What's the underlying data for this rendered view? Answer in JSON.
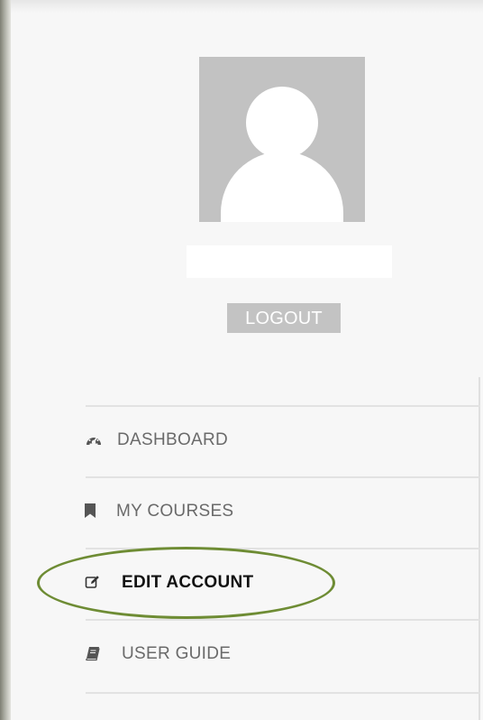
{
  "profile": {
    "username": "",
    "logout_label": "LOGOUT"
  },
  "menu": {
    "items": [
      {
        "label": "DASHBOARD",
        "icon": "dashboard-icon",
        "active": false
      },
      {
        "label": "MY COURSES",
        "icon": "bookmark-icon",
        "active": false
      },
      {
        "label": "EDIT ACCOUNT",
        "icon": "edit-icon",
        "active": true
      },
      {
        "label": "USER GUIDE",
        "icon": "book-icon",
        "active": false
      }
    ]
  },
  "colors": {
    "background": "#f7f7f7",
    "avatar_bg": "#c2c2c2",
    "logout_bg": "#c3c3c3",
    "menu_text": "#6a6a6a",
    "active_text": "#111111",
    "highlight": "#6e8c34"
  }
}
